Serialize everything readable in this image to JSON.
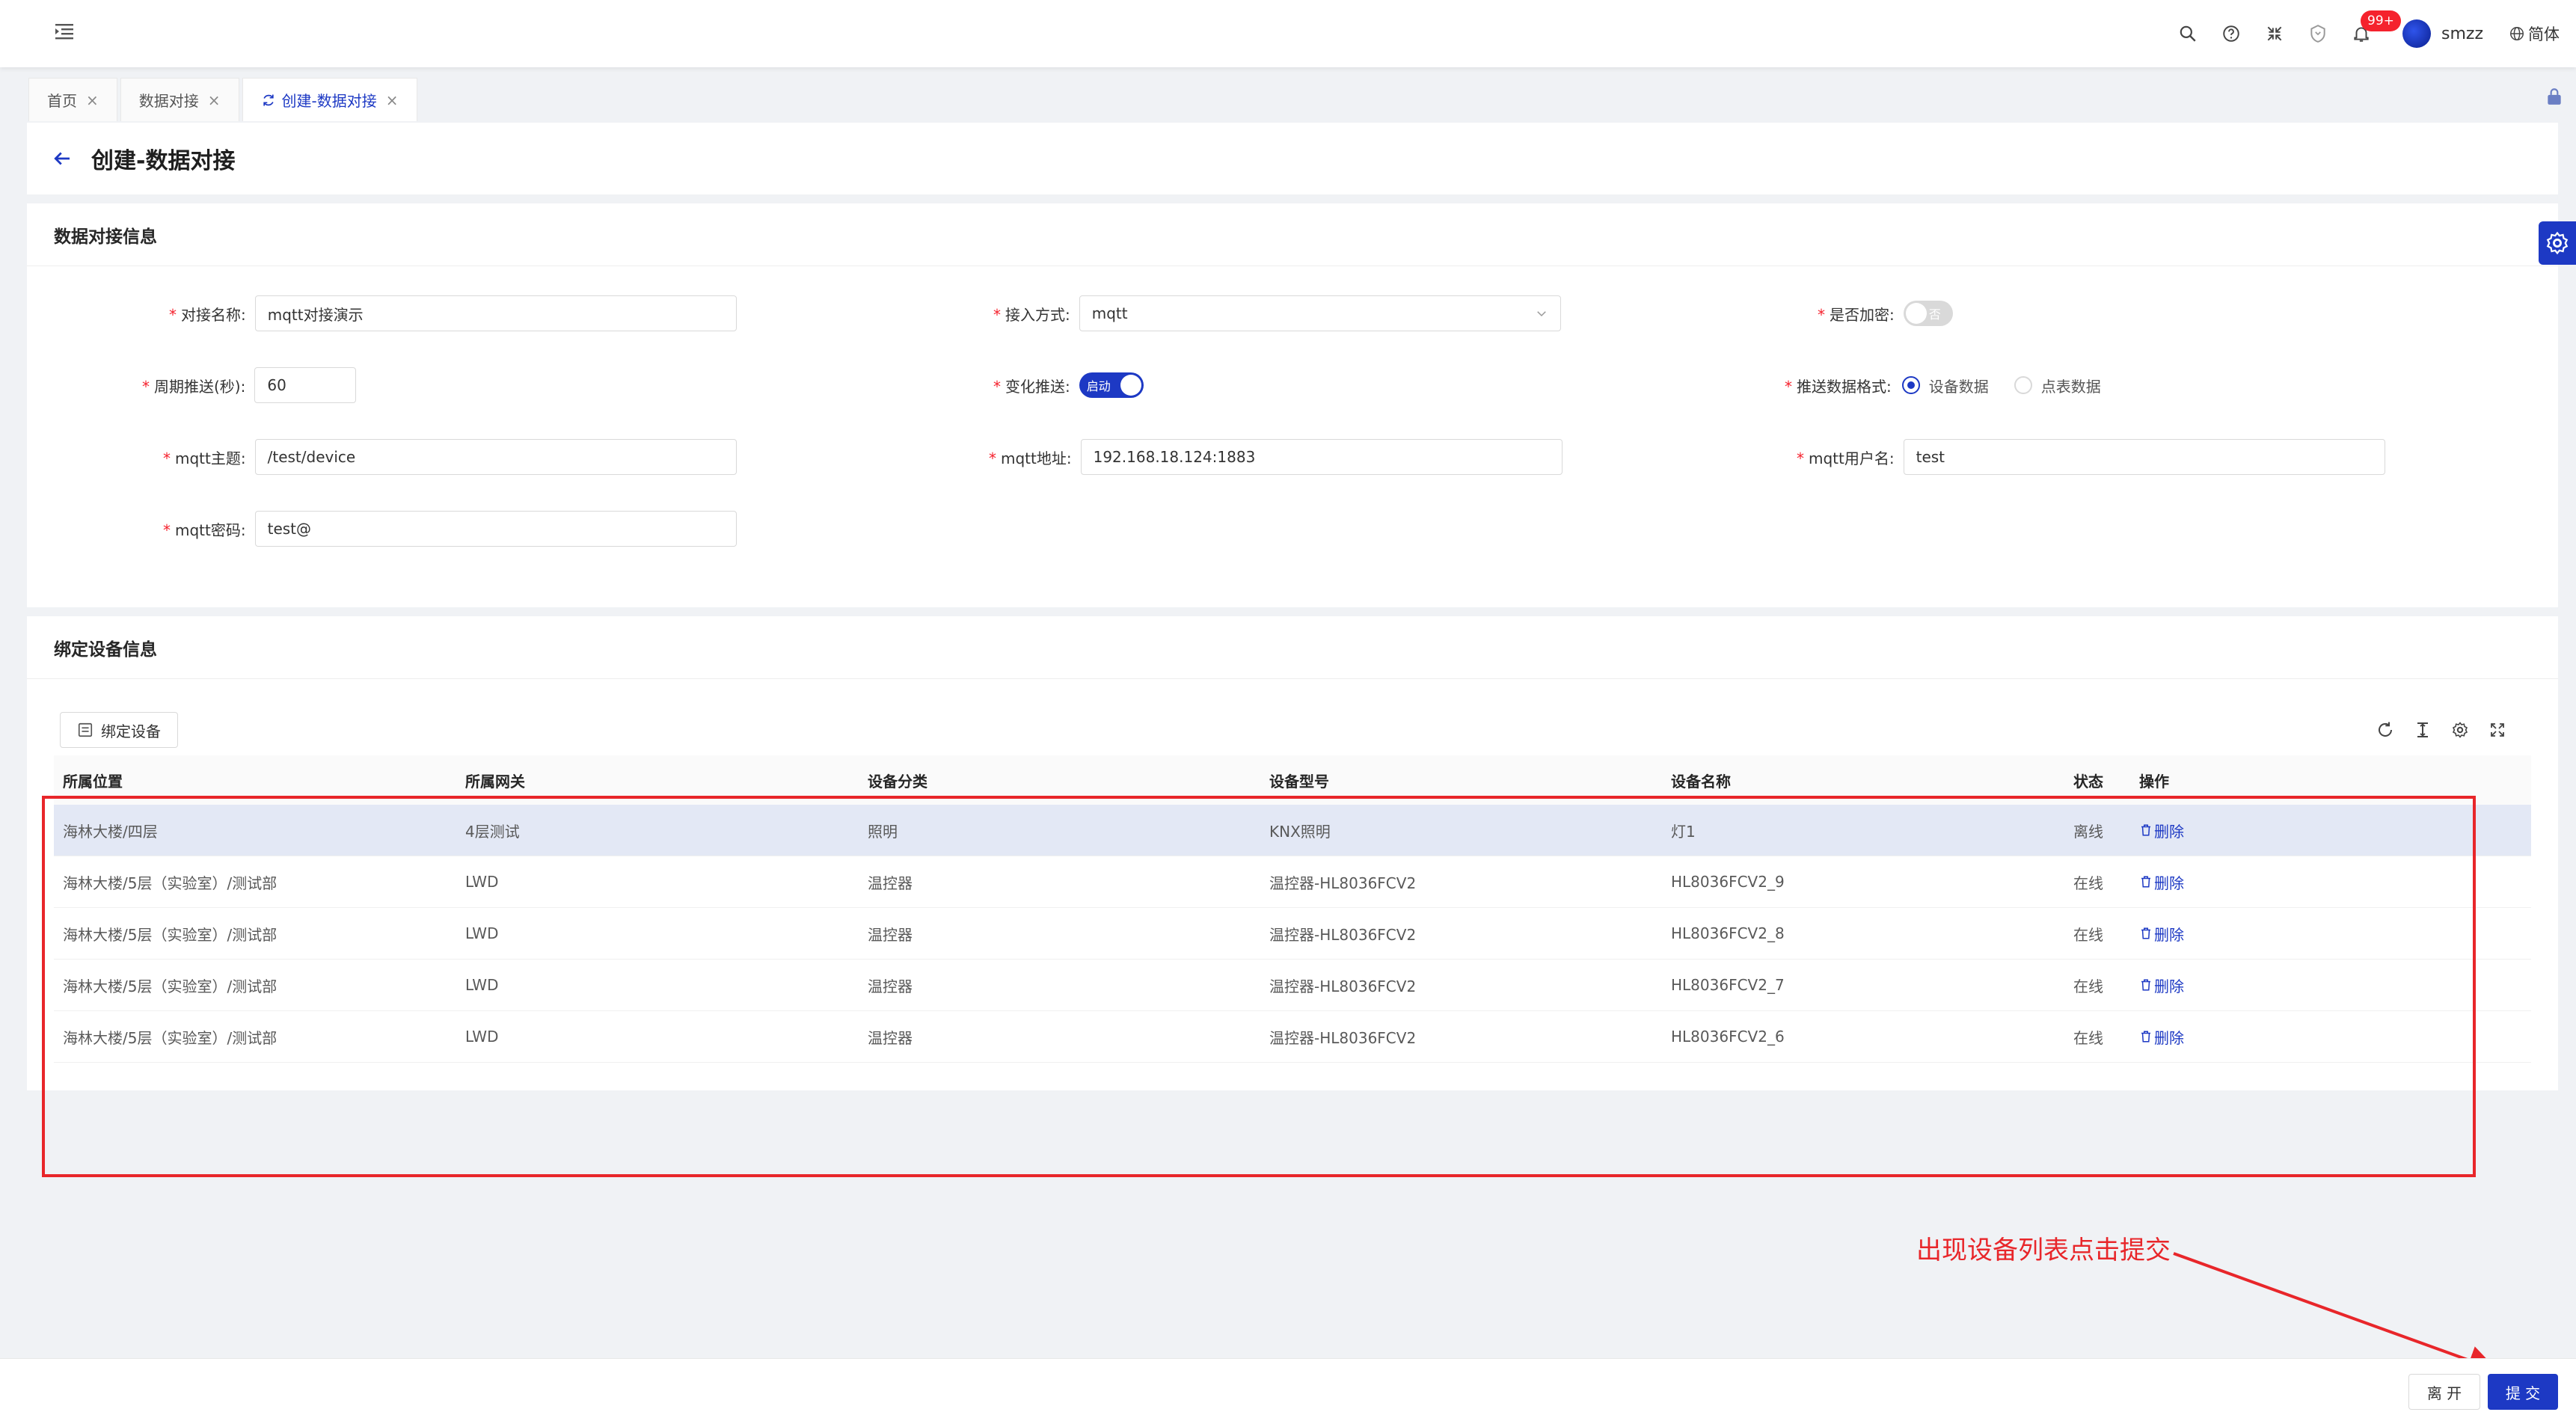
{
  "header": {
    "notification_badge": "99+",
    "username": "smzz",
    "language": "简体"
  },
  "tabs": [
    {
      "label": "首页",
      "active": false
    },
    {
      "label": "数据对接",
      "active": false
    },
    {
      "label": "创建-数据对接",
      "active": true
    }
  ],
  "page_title": "创建-数据对接",
  "info_section": {
    "title": "数据对接信息",
    "fields": {
      "name": {
        "label": "对接名称:",
        "value": "mqtt对接演示"
      },
      "access_mode": {
        "label": "接入方式:",
        "value": "mqtt"
      },
      "encrypt": {
        "label": "是否加密:",
        "switch_text": "否"
      },
      "period": {
        "label": "周期推送(秒):",
        "value": "60"
      },
      "change_push": {
        "label": "变化推送:",
        "switch_text": "启动"
      },
      "push_format": {
        "label": "推送数据格式:",
        "options": [
          "设备数据",
          "点表数据"
        ],
        "selected": "设备数据"
      },
      "mqtt_topic": {
        "label": "mqtt主题:",
        "value": "/test/device"
      },
      "mqtt_address": {
        "label": "mqtt地址:",
        "value": "192.168.18.124:1883"
      },
      "mqtt_username": {
        "label": "mqtt用户名:",
        "value": "test"
      },
      "mqtt_password": {
        "label": "mqtt密码:",
        "value": "test@"
      }
    }
  },
  "bind_section": {
    "title": "绑定设备信息",
    "bind_button": "绑定设备",
    "columns": [
      "所属位置",
      "所属网关",
      "设备分类",
      "设备型号",
      "设备名称",
      "状态",
      "操作"
    ],
    "delete_label": "删除",
    "rows": [
      {
        "location": "海林大楼/四层",
        "gateway": "4层测试",
        "category": "照明",
        "model": "KNX照明",
        "name": "灯1",
        "status": "离线"
      },
      {
        "location": "海林大楼/5层（实验室）/测试部",
        "gateway": "LWD",
        "category": "温控器",
        "model": "温控器-HL8036FCV2",
        "name": "HL8036FCV2_9",
        "status": "在线"
      },
      {
        "location": "海林大楼/5层（实验室）/测试部",
        "gateway": "LWD",
        "category": "温控器",
        "model": "温控器-HL8036FCV2",
        "name": "HL8036FCV2_8",
        "status": "在线"
      },
      {
        "location": "海林大楼/5层（实验室）/测试部",
        "gateway": "LWD",
        "category": "温控器",
        "model": "温控器-HL8036FCV2",
        "name": "HL8036FCV2_7",
        "status": "在线"
      },
      {
        "location": "海林大楼/5层（实验室）/测试部",
        "gateway": "LWD",
        "category": "温控器",
        "model": "温控器-HL8036FCV2",
        "name": "HL8036FCV2_6",
        "status": "在线"
      }
    ]
  },
  "annotation": {
    "text": "出现设备列表点击提交",
    "color": "#e8262a"
  },
  "footer": {
    "leave_label": "离 开",
    "submit_label": "提 交"
  },
  "colors": {
    "primary": "#1d39c4",
    "danger": "#f5222d",
    "highlight_row": "#e3e8f5"
  }
}
